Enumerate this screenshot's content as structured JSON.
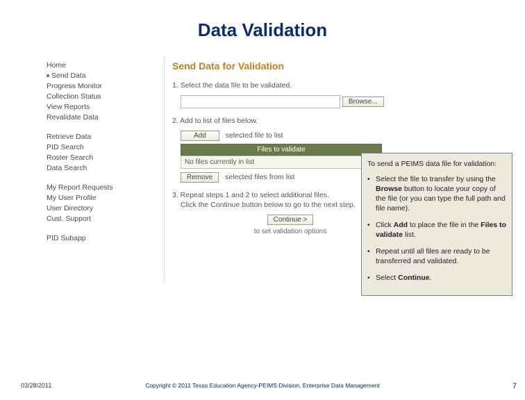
{
  "title": "Data Validation",
  "sidebar": {
    "groups": [
      {
        "items": [
          {
            "label": "Home",
            "active": false
          },
          {
            "label": "Send Data",
            "active": true
          },
          {
            "label": "Progress Monitor",
            "active": false
          },
          {
            "label": "Collection Status",
            "active": false
          },
          {
            "label": "View Reports",
            "active": false
          },
          {
            "label": "Revalidate Data",
            "active": false
          }
        ]
      },
      {
        "items": [
          {
            "label": "Retrieve Data",
            "active": false
          },
          {
            "label": "PID Search",
            "active": false
          },
          {
            "label": "Roster Search",
            "active": false
          },
          {
            "label": "Data Search",
            "active": false
          }
        ]
      },
      {
        "items": [
          {
            "label": "My Report Requests",
            "active": false
          },
          {
            "label": "My User Profile",
            "active": false
          },
          {
            "label": "User Directory",
            "active": false
          },
          {
            "label": "Cust. Support",
            "active": false
          }
        ]
      },
      {
        "items": [
          {
            "label": "PID Subapp",
            "active": false
          }
        ]
      }
    ]
  },
  "content": {
    "heading": "Send Data for Validation",
    "step1": "1. Select the data file to be validated.",
    "browse_btn": "Browse...",
    "step2": "2. Add to list of files below.",
    "add_btn": "Add",
    "add_note": "selected file to list",
    "table_header": "Files to validate",
    "table_empty": "No files currently in list",
    "remove_btn": "Remove",
    "remove_note": "selected files from list",
    "step3a": "3. Repeat steps 1 and 2 to select additional files.",
    "step3b": "Click the Continue button below to go to the next step.",
    "continue_btn": "Continue >",
    "continue_note": "to set validation options"
  },
  "callout": {
    "lead": "To send a PEIMS data file for validation:",
    "b1_pre": "Select the file to transfer by using the ",
    "b1_bold": "Browse",
    "b1_post": " button to locate your copy of the file (or you can type the full path and file name).",
    "b2_pre": "Click ",
    "b2_bold1": "Add",
    "b2_mid": " to place the file in the ",
    "b2_bold2": "Files to validate",
    "b2_post": " list.",
    "b3": "Repeat until all files are ready to be transferred and validated.",
    "b4_pre": "Select ",
    "b4_bold": "Continue",
    "b4_post": "."
  },
  "footer": {
    "date": "03/28/2011",
    "copyright": "Copyright © 2011 Texas Education Agency-PEIMS Division, Enterprise Data Management",
    "page": "7"
  }
}
